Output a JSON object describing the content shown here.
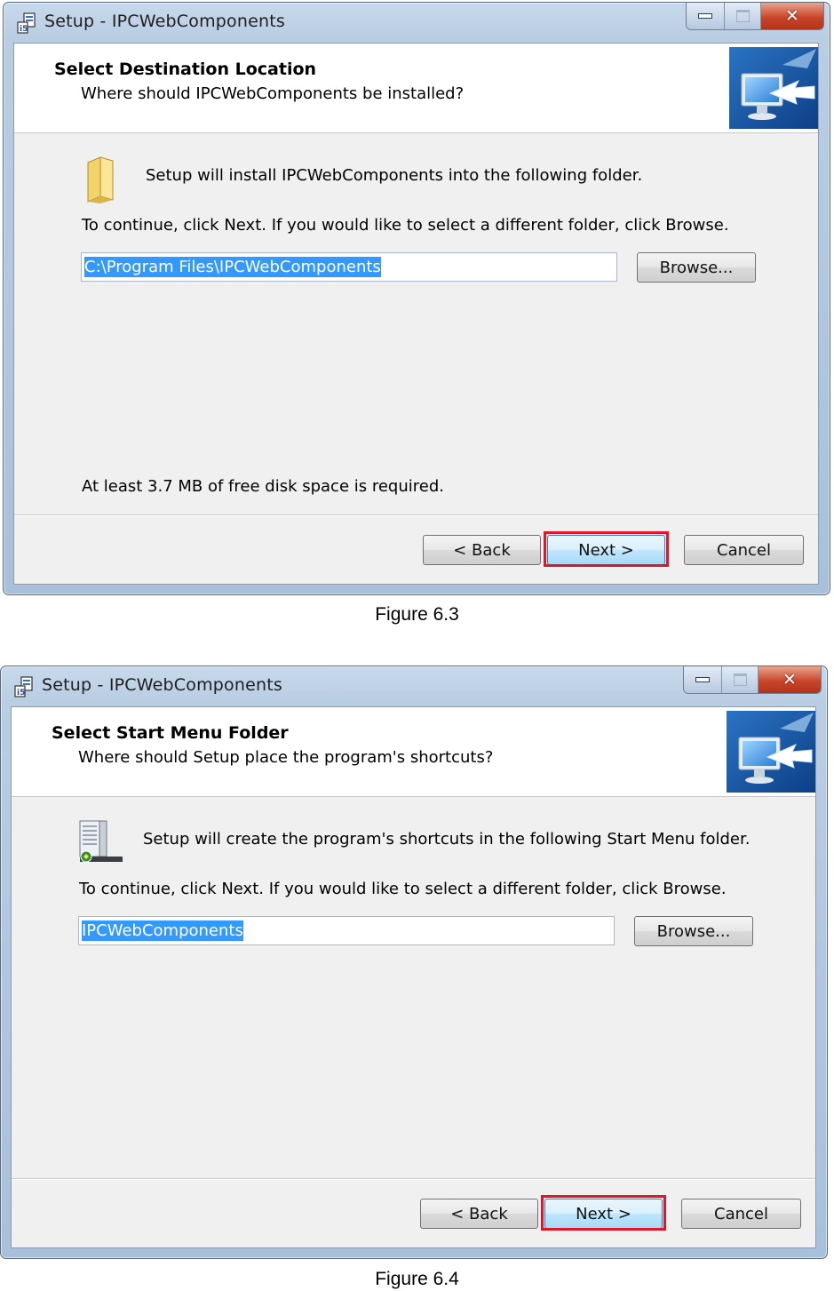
{
  "figures": [
    {
      "window_title": "Setup - IPCWebComponents",
      "header_title": "Select Destination Location",
      "header_subtitle": "Where should IPCWebComponents be installed?",
      "intro_text": "Setup will install IPCWebComponents into the following folder.",
      "instruction_text": "To continue, click Next. If you would like to select a different folder, click Browse.",
      "input_value": "C:\\Program Files\\IPCWebComponents",
      "browse_label": "Browse...",
      "disk_space_text": "At least 3.7 MB of free disk space is required.",
      "back_label": "< Back",
      "next_label": "Next >",
      "cancel_label": "Cancel",
      "caption": "Figure 6.3",
      "body_icon": "folder-icon"
    },
    {
      "window_title": "Setup - IPCWebComponents",
      "header_title": "Select Start Menu Folder",
      "header_subtitle": "Where should Setup place the program's shortcuts?",
      "intro_text": "Setup will create the program's shortcuts in the following Start Menu folder.",
      "instruction_text": "To continue, click Next. If you would like to select a different folder, click Browse.",
      "input_value": "IPCWebComponents",
      "browse_label": "Browse...",
      "back_label": "< Back",
      "next_label": "Next >",
      "cancel_label": "Cancel",
      "caption": "Figure 6.4",
      "body_icon": "start-menu-folder-icon"
    }
  ],
  "colors": {
    "highlight": "#e0162b",
    "selection": "#3399ff",
    "close_button": "#c9462b"
  },
  "icons": {
    "app": "setup-app-icon",
    "header": "computer-monitor-icon"
  }
}
